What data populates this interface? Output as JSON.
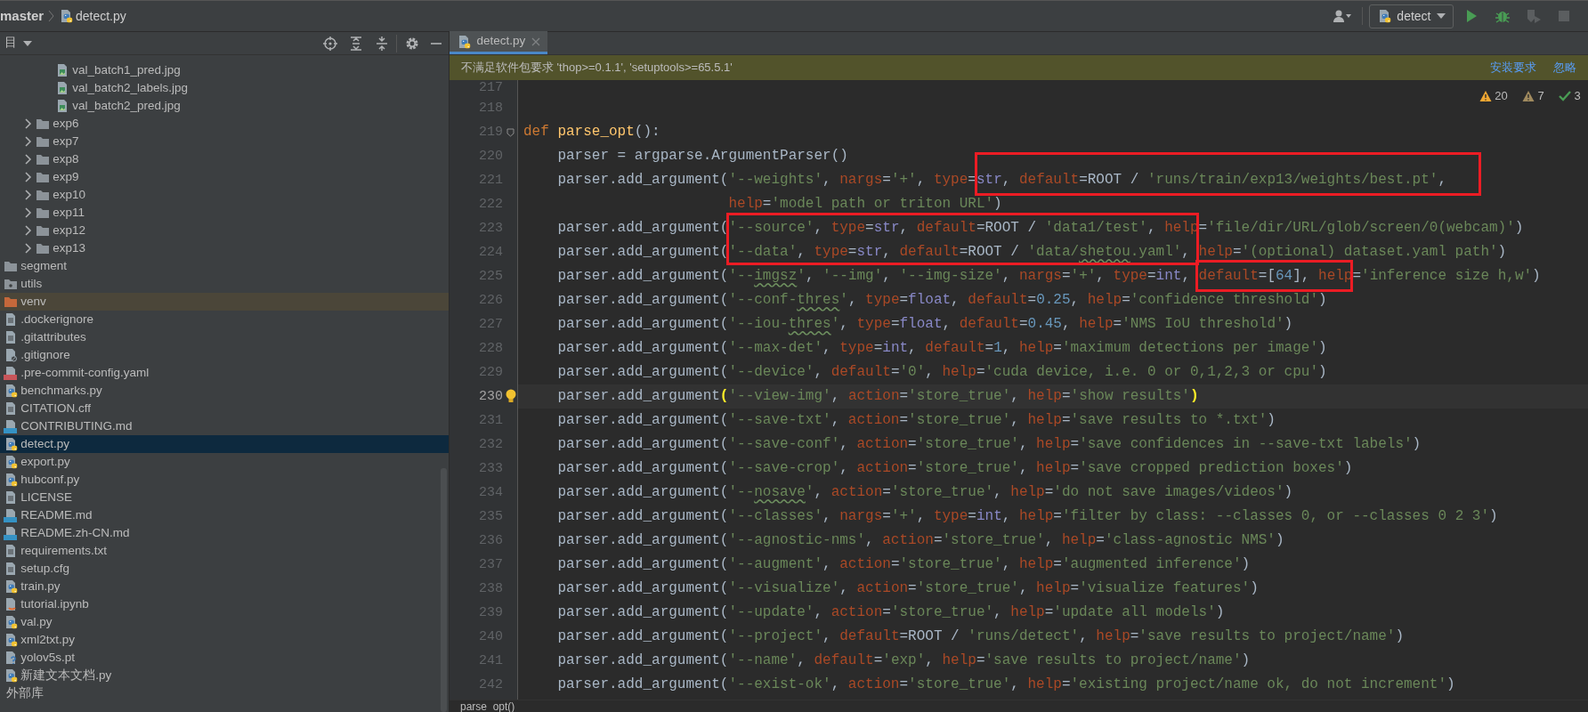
{
  "breadcrumb": [
    {
      "kind": "branch",
      "text": "master"
    },
    {
      "kind": "python",
      "text": "detect.py"
    }
  ],
  "run_config": {
    "name": "detect"
  },
  "run_buttons": [
    {
      "kind": "run",
      "disabled": false
    },
    {
      "kind": "debug",
      "disabled": false
    },
    {
      "kind": "coverage",
      "disabled": true
    },
    {
      "kind": "stop",
      "disabled": true
    }
  ],
  "project_panel": {
    "title": "目",
    "tree": [
      {
        "children": [
          {
            "children": [
              {
                "name": "val_batch1_pred.jpg",
                "kind": "image",
                "selected": false
              },
              {
                "name": "val_batch2_labels.jpg",
                "kind": "image",
                "selected": false
              },
              {
                "name": "val_batch2_pred.jpg",
                "kind": "image",
                "selected": false
              }
            ]
          },
          {
            "name": "exp6",
            "kind": "folder",
            "expanded": false,
            "excluded": false,
            "selected": false
          },
          {
            "name": "exp7",
            "kind": "folder",
            "expanded": false,
            "excluded": false,
            "selected": false
          },
          {
            "name": "exp8",
            "kind": "folder",
            "expanded": false,
            "excluded": false,
            "selected": false
          },
          {
            "name": "exp9",
            "kind": "folder",
            "expanded": false,
            "excluded": false,
            "selected": false
          },
          {
            "name": "exp10",
            "kind": "folder",
            "expanded": false,
            "excluded": false,
            "selected": false
          },
          {
            "name": "exp11",
            "kind": "folder",
            "expanded": false,
            "excluded": false,
            "selected": false
          },
          {
            "name": "exp12",
            "kind": "folder",
            "expanded": false,
            "excluded": false,
            "selected": false
          },
          {
            "name": "exp13",
            "kind": "folder",
            "expanded": false,
            "excluded": false,
            "selected": false
          }
        ]
      },
      {
        "name": "segment",
        "kind": "folder",
        "excluded": false,
        "selected": false
      },
      {
        "name": "utils",
        "kind": "package",
        "excluded": false,
        "selected": false
      },
      {
        "name": "venv",
        "kind": "folder",
        "excluded": true,
        "selected": false
      },
      {
        "name": ".dockerignore",
        "kind": "text",
        "selected": false
      },
      {
        "name": ".gitattributes",
        "kind": "text",
        "selected": false
      },
      {
        "name": ".gitignore",
        "kind": "ignore",
        "selected": false
      },
      {
        "name": ".pre-commit-config.yaml",
        "kind": "yaml",
        "selected": false
      },
      {
        "name": "benchmarks.py",
        "kind": "python",
        "selected": false
      },
      {
        "name": "CITATION.cff",
        "kind": "text",
        "selected": false
      },
      {
        "name": "CONTRIBUTING.md",
        "kind": "markdown",
        "selected": false
      },
      {
        "name": "detect.py",
        "kind": "python",
        "selected": true
      },
      {
        "name": "export.py",
        "kind": "python",
        "selected": false
      },
      {
        "name": "hubconf.py",
        "kind": "python",
        "selected": false
      },
      {
        "name": "LICENSE",
        "kind": "text",
        "selected": false
      },
      {
        "name": "README.md",
        "kind": "markdown",
        "selected": false
      },
      {
        "name": "README.zh-CN.md",
        "kind": "markdown",
        "selected": false
      },
      {
        "name": "requirements.txt",
        "kind": "text",
        "selected": false
      },
      {
        "name": "setup.cfg",
        "kind": "text",
        "selected": false
      },
      {
        "name": "train.py",
        "kind": "python",
        "selected": false
      },
      {
        "name": "tutorial.ipynb",
        "kind": "notebook",
        "selected": false
      },
      {
        "name": "val.py",
        "kind": "python",
        "selected": false
      },
      {
        "name": "xml2txt.py",
        "kind": "python",
        "selected": false
      },
      {
        "name": "yolov5s.pt",
        "kind": "unknown",
        "selected": false
      },
      {
        "name": "新建文本文档.py",
        "kind": "python",
        "selected": false
      },
      {
        "name": "外部库",
        "kind": "section",
        "selected": false
      }
    ]
  },
  "editor": {
    "tabs": [
      {
        "label": "detect.py",
        "kind": "python",
        "selected": true
      }
    ],
    "banner": {
      "message": "不满足软件包要求 'thop>=0.1.1', 'setuptools>=65.5.1'",
      "actions": [
        "安装要求",
        "忽略"
      ]
    },
    "inspections": [
      {
        "kind": "warning",
        "count": "20"
      },
      {
        "kind": "weak",
        "count": "7"
      },
      {
        "kind": "ok",
        "count": "3"
      }
    ],
    "lines": [
      {
        "number": "217",
        "kind": "code",
        "current": false
      },
      {
        "number": "218",
        "kind": "code",
        "current": false
      },
      {
        "number": "219",
        "kind": "fold",
        "current": false,
        "tokens": [
          {
            "kind": "keyword",
            "text": "def "
          },
          {
            "kind": "function",
            "text": "parse_opt"
          },
          {
            "kind": "plain",
            "text": "():"
          }
        ]
      },
      {
        "number": "220",
        "kind": "code",
        "current": false,
        "tokens": [
          {
            "kind": "plain",
            "text": "    parser = argparse.ArgumentParser()"
          }
        ]
      },
      {
        "number": "221",
        "kind": "code",
        "current": false,
        "tokens": [
          {
            "kind": "plain",
            "text": "    parser.add_argument("
          },
          {
            "kind": "string",
            "text": "'--weights'"
          },
          {
            "kind": "plain",
            "text": ", "
          },
          {
            "kind": "kwarg",
            "text": "nargs"
          },
          {
            "kind": "plain",
            "text": "="
          },
          {
            "kind": "string",
            "text": "'+'"
          },
          {
            "kind": "plain",
            "text": ", "
          },
          {
            "kind": "kwarg",
            "text": "type"
          },
          {
            "kind": "plain",
            "text": "="
          },
          {
            "kind": "builtin",
            "text": "str"
          },
          {
            "kind": "plain",
            "text": ", "
          },
          {
            "kind": "kwarg",
            "text": "default"
          },
          {
            "kind": "plain",
            "text": "=ROOT / "
          },
          {
            "kind": "string",
            "text": "'runs/train/exp13/weights/best.pt'"
          },
          {
            "kind": "plain",
            "text": ","
          }
        ]
      },
      {
        "number": "222",
        "kind": "code",
        "current": false,
        "tokens": [
          {
            "kind": "kwarg",
            "text": "                        help"
          },
          {
            "kind": "plain",
            "text": "="
          },
          {
            "kind": "string",
            "text": "'model path or triton URL'"
          },
          {
            "kind": "plain",
            "text": ")"
          }
        ]
      },
      {
        "number": "223",
        "kind": "code",
        "current": false,
        "tokens": [
          {
            "kind": "plain",
            "text": "    parser.add_argument("
          },
          {
            "kind": "string",
            "text": "'--source'"
          },
          {
            "kind": "plain",
            "text": ", "
          },
          {
            "kind": "kwarg",
            "text": "type"
          },
          {
            "kind": "plain",
            "text": "="
          },
          {
            "kind": "builtin",
            "text": "str"
          },
          {
            "kind": "plain",
            "text": ", "
          },
          {
            "kind": "kwarg",
            "text": "default"
          },
          {
            "kind": "plain",
            "text": "=ROOT / "
          },
          {
            "kind": "string",
            "text": "'data1/test'"
          },
          {
            "kind": "plain",
            "text": ", "
          },
          {
            "kind": "kwarg",
            "text": "help"
          },
          {
            "kind": "plain",
            "text": "="
          },
          {
            "kind": "string",
            "text": "'file/dir/URL/glob/screen/0(webcam)'"
          },
          {
            "kind": "plain",
            "text": ")"
          }
        ]
      },
      {
        "number": "224",
        "kind": "code",
        "current": false,
        "tokens": [
          {
            "kind": "plain",
            "text": "    parser.add_argument("
          },
          {
            "kind": "string",
            "text": "'--data'"
          },
          {
            "kind": "plain",
            "text": ", "
          },
          {
            "kind": "kwarg",
            "text": "type"
          },
          {
            "kind": "plain",
            "text": "="
          },
          {
            "kind": "builtin",
            "text": "str"
          },
          {
            "kind": "plain",
            "text": ", "
          },
          {
            "kind": "kwarg",
            "text": "default"
          },
          {
            "kind": "plain",
            "text": "=ROOT / "
          },
          {
            "kind": "string",
            "text": "'data/"
          },
          {
            "kind": "typo",
            "text": "shetou"
          },
          {
            "kind": "string",
            "text": ".yaml'"
          },
          {
            "kind": "plain",
            "text": ", "
          },
          {
            "kind": "kwarg",
            "text": "help"
          },
          {
            "kind": "plain",
            "text": "="
          },
          {
            "kind": "string",
            "text": "'(optional) dataset.yaml path'"
          },
          {
            "kind": "plain",
            "text": ")"
          }
        ]
      },
      {
        "number": "225",
        "kind": "code",
        "current": false,
        "tokens": [
          {
            "kind": "plain",
            "text": "    parser.add_argument("
          },
          {
            "kind": "string",
            "text": "'--"
          },
          {
            "kind": "typo",
            "text": "imgsz"
          },
          {
            "kind": "string",
            "text": "'"
          },
          {
            "kind": "plain",
            "text": ", "
          },
          {
            "kind": "string",
            "text": "'--img'"
          },
          {
            "kind": "plain",
            "text": ", "
          },
          {
            "kind": "string",
            "text": "'--img-size'"
          },
          {
            "kind": "plain",
            "text": ", "
          },
          {
            "kind": "kwarg",
            "text": "nargs"
          },
          {
            "kind": "plain",
            "text": "="
          },
          {
            "kind": "string",
            "text": "'+'"
          },
          {
            "kind": "plain",
            "text": ", "
          },
          {
            "kind": "kwarg",
            "text": "type"
          },
          {
            "kind": "plain",
            "text": "="
          },
          {
            "kind": "builtin",
            "text": "int"
          },
          {
            "kind": "plain",
            "text": ", "
          },
          {
            "kind": "kwarg",
            "text": "default"
          },
          {
            "kind": "plain",
            "text": "=["
          },
          {
            "kind": "number",
            "text": "64"
          },
          {
            "kind": "plain",
            "text": "], "
          },
          {
            "kind": "kwarg",
            "text": "help"
          },
          {
            "kind": "plain",
            "text": "="
          },
          {
            "kind": "string",
            "text": "'inference size h,w'"
          },
          {
            "kind": "plain",
            "text": ")"
          }
        ]
      },
      {
        "number": "226",
        "kind": "code",
        "current": false,
        "tokens": [
          {
            "kind": "plain",
            "text": "    parser.add_argument("
          },
          {
            "kind": "string",
            "text": "'--conf-"
          },
          {
            "kind": "typo",
            "text": "thres"
          },
          {
            "kind": "string",
            "text": "'"
          },
          {
            "kind": "plain",
            "text": ", "
          },
          {
            "kind": "kwarg",
            "text": "type"
          },
          {
            "kind": "plain",
            "text": "="
          },
          {
            "kind": "builtin",
            "text": "float"
          },
          {
            "kind": "plain",
            "text": ", "
          },
          {
            "kind": "kwarg",
            "text": "default"
          },
          {
            "kind": "plain",
            "text": "="
          },
          {
            "kind": "number",
            "text": "0.25"
          },
          {
            "kind": "plain",
            "text": ", "
          },
          {
            "kind": "kwarg",
            "text": "help"
          },
          {
            "kind": "plain",
            "text": "="
          },
          {
            "kind": "string",
            "text": "'confidence threshold'"
          },
          {
            "kind": "plain",
            "text": ")"
          }
        ]
      },
      {
        "number": "227",
        "kind": "code",
        "current": false,
        "tokens": [
          {
            "kind": "plain",
            "text": "    parser.add_argument("
          },
          {
            "kind": "string",
            "text": "'--iou-"
          },
          {
            "kind": "typo",
            "text": "thres"
          },
          {
            "kind": "string",
            "text": "'"
          },
          {
            "kind": "plain",
            "text": ", "
          },
          {
            "kind": "kwarg",
            "text": "type"
          },
          {
            "kind": "plain",
            "text": "="
          },
          {
            "kind": "builtin",
            "text": "float"
          },
          {
            "kind": "plain",
            "text": ", "
          },
          {
            "kind": "kwarg",
            "text": "default"
          },
          {
            "kind": "plain",
            "text": "="
          },
          {
            "kind": "number",
            "text": "0.45"
          },
          {
            "kind": "plain",
            "text": ", "
          },
          {
            "kind": "kwarg",
            "text": "help"
          },
          {
            "kind": "plain",
            "text": "="
          },
          {
            "kind": "string",
            "text": "'NMS IoU threshold'"
          },
          {
            "kind": "plain",
            "text": ")"
          }
        ]
      },
      {
        "number": "228",
        "kind": "code",
        "current": false,
        "tokens": [
          {
            "kind": "plain",
            "text": "    parser.add_argument("
          },
          {
            "kind": "string",
            "text": "'--max-det'"
          },
          {
            "kind": "plain",
            "text": ", "
          },
          {
            "kind": "kwarg",
            "text": "type"
          },
          {
            "kind": "plain",
            "text": "="
          },
          {
            "kind": "builtin",
            "text": "int"
          },
          {
            "kind": "plain",
            "text": ", "
          },
          {
            "kind": "kwarg",
            "text": "default"
          },
          {
            "kind": "plain",
            "text": "="
          },
          {
            "kind": "number",
            "text": "1"
          },
          {
            "kind": "plain",
            "text": ", "
          },
          {
            "kind": "kwarg",
            "text": "help"
          },
          {
            "kind": "plain",
            "text": "="
          },
          {
            "kind": "string",
            "text": "'maximum detections per image'"
          },
          {
            "kind": "plain",
            "text": ")"
          }
        ]
      },
      {
        "number": "229",
        "kind": "code",
        "current": false,
        "tokens": [
          {
            "kind": "plain",
            "text": "    parser.add_argument("
          },
          {
            "kind": "string",
            "text": "'--device'"
          },
          {
            "kind": "plain",
            "text": ", "
          },
          {
            "kind": "kwarg",
            "text": "default"
          },
          {
            "kind": "plain",
            "text": "="
          },
          {
            "kind": "string",
            "text": "'0'"
          },
          {
            "kind": "plain",
            "text": ", "
          },
          {
            "kind": "kwarg",
            "text": "help"
          },
          {
            "kind": "plain",
            "text": "="
          },
          {
            "kind": "string",
            "text": "'cuda device, i.e. 0 or 0,1,2,3 or cpu'"
          },
          {
            "kind": "plain",
            "text": ")"
          }
        ]
      },
      {
        "number": "230",
        "kind": "bulb",
        "current": true,
        "tokens": [
          {
            "kind": "plain",
            "text": "    parser.add_argument"
          },
          {
            "kind": "brace",
            "text": "("
          },
          {
            "kind": "string",
            "text": "'--view-img'"
          },
          {
            "kind": "plain",
            "text": ", "
          },
          {
            "kind": "kwarg",
            "text": "action"
          },
          {
            "kind": "plain",
            "text": "="
          },
          {
            "kind": "string",
            "text": "'store_true'"
          },
          {
            "kind": "plain",
            "text": ", "
          },
          {
            "kind": "kwarg",
            "text": "help"
          },
          {
            "kind": "plain",
            "text": "="
          },
          {
            "kind": "string",
            "text": "'show results'"
          },
          {
            "kind": "brace",
            "text": ")"
          }
        ]
      },
      {
        "number": "231",
        "kind": "code",
        "current": false,
        "tokens": [
          {
            "kind": "plain",
            "text": "    parser.add_argument("
          },
          {
            "kind": "string",
            "text": "'--save-txt'"
          },
          {
            "kind": "plain",
            "text": ", "
          },
          {
            "kind": "kwarg",
            "text": "action"
          },
          {
            "kind": "plain",
            "text": "="
          },
          {
            "kind": "string",
            "text": "'store_true'"
          },
          {
            "kind": "plain",
            "text": ", "
          },
          {
            "kind": "kwarg",
            "text": "help"
          },
          {
            "kind": "plain",
            "text": "="
          },
          {
            "kind": "string",
            "text": "'save results to *.txt'"
          },
          {
            "kind": "plain",
            "text": ")"
          }
        ]
      },
      {
        "number": "232",
        "kind": "code",
        "current": false,
        "tokens": [
          {
            "kind": "plain",
            "text": "    parser.add_argument("
          },
          {
            "kind": "string",
            "text": "'--save-conf'"
          },
          {
            "kind": "plain",
            "text": ", "
          },
          {
            "kind": "kwarg",
            "text": "action"
          },
          {
            "kind": "plain",
            "text": "="
          },
          {
            "kind": "string",
            "text": "'store_true'"
          },
          {
            "kind": "plain",
            "text": ", "
          },
          {
            "kind": "kwarg",
            "text": "help"
          },
          {
            "kind": "plain",
            "text": "="
          },
          {
            "kind": "string",
            "text": "'save confidences in --save-txt labels'"
          },
          {
            "kind": "plain",
            "text": ")"
          }
        ]
      },
      {
        "number": "233",
        "kind": "code",
        "current": false,
        "tokens": [
          {
            "kind": "plain",
            "text": "    parser.add_argument("
          },
          {
            "kind": "string",
            "text": "'--save-crop'"
          },
          {
            "kind": "plain",
            "text": ", "
          },
          {
            "kind": "kwarg",
            "text": "action"
          },
          {
            "kind": "plain",
            "text": "="
          },
          {
            "kind": "string",
            "text": "'store_true'"
          },
          {
            "kind": "plain",
            "text": ", "
          },
          {
            "kind": "kwarg",
            "text": "help"
          },
          {
            "kind": "plain",
            "text": "="
          },
          {
            "kind": "string",
            "text": "'save cropped prediction boxes'"
          },
          {
            "kind": "plain",
            "text": ")"
          }
        ]
      },
      {
        "number": "234",
        "kind": "code",
        "current": false,
        "tokens": [
          {
            "kind": "plain",
            "text": "    parser.add_argument("
          },
          {
            "kind": "string",
            "text": "'--"
          },
          {
            "kind": "typo",
            "text": "nosave"
          },
          {
            "kind": "string",
            "text": "'"
          },
          {
            "kind": "plain",
            "text": ", "
          },
          {
            "kind": "kwarg",
            "text": "action"
          },
          {
            "kind": "plain",
            "text": "="
          },
          {
            "kind": "string",
            "text": "'store_true'"
          },
          {
            "kind": "plain",
            "text": ", "
          },
          {
            "kind": "kwarg",
            "text": "help"
          },
          {
            "kind": "plain",
            "text": "="
          },
          {
            "kind": "string",
            "text": "'do not save images/videos'"
          },
          {
            "kind": "plain",
            "text": ")"
          }
        ]
      },
      {
        "number": "235",
        "kind": "code",
        "current": false,
        "tokens": [
          {
            "kind": "plain",
            "text": "    parser.add_argument("
          },
          {
            "kind": "string",
            "text": "'--classes'"
          },
          {
            "kind": "plain",
            "text": ", "
          },
          {
            "kind": "kwarg",
            "text": "nargs"
          },
          {
            "kind": "plain",
            "text": "="
          },
          {
            "kind": "string",
            "text": "'+'"
          },
          {
            "kind": "plain",
            "text": ", "
          },
          {
            "kind": "kwarg",
            "text": "type"
          },
          {
            "kind": "plain",
            "text": "="
          },
          {
            "kind": "builtin",
            "text": "int"
          },
          {
            "kind": "plain",
            "text": ", "
          },
          {
            "kind": "kwarg",
            "text": "help"
          },
          {
            "kind": "plain",
            "text": "="
          },
          {
            "kind": "string",
            "text": "'filter by class: --classes 0, or --classes 0 2 3'"
          },
          {
            "kind": "plain",
            "text": ")"
          }
        ]
      },
      {
        "number": "236",
        "kind": "code",
        "current": false,
        "tokens": [
          {
            "kind": "plain",
            "text": "    parser.add_argument("
          },
          {
            "kind": "string",
            "text": "'--agnostic-nms'"
          },
          {
            "kind": "plain",
            "text": ", "
          },
          {
            "kind": "kwarg",
            "text": "action"
          },
          {
            "kind": "plain",
            "text": "="
          },
          {
            "kind": "string",
            "text": "'store_true'"
          },
          {
            "kind": "plain",
            "text": ", "
          },
          {
            "kind": "kwarg",
            "text": "help"
          },
          {
            "kind": "plain",
            "text": "="
          },
          {
            "kind": "string",
            "text": "'class-agnostic NMS'"
          },
          {
            "kind": "plain",
            "text": ")"
          }
        ]
      },
      {
        "number": "237",
        "kind": "code",
        "current": false,
        "tokens": [
          {
            "kind": "plain",
            "text": "    parser.add_argument("
          },
          {
            "kind": "string",
            "text": "'--augment'"
          },
          {
            "kind": "plain",
            "text": ", "
          },
          {
            "kind": "kwarg",
            "text": "action"
          },
          {
            "kind": "plain",
            "text": "="
          },
          {
            "kind": "string",
            "text": "'store_true'"
          },
          {
            "kind": "plain",
            "text": ", "
          },
          {
            "kind": "kwarg",
            "text": "help"
          },
          {
            "kind": "plain",
            "text": "="
          },
          {
            "kind": "string",
            "text": "'augmented inference'"
          },
          {
            "kind": "plain",
            "text": ")"
          }
        ]
      },
      {
        "number": "238",
        "kind": "code",
        "current": false,
        "tokens": [
          {
            "kind": "plain",
            "text": "    parser.add_argument("
          },
          {
            "kind": "string",
            "text": "'--visualize'"
          },
          {
            "kind": "plain",
            "text": ", "
          },
          {
            "kind": "kwarg",
            "text": "action"
          },
          {
            "kind": "plain",
            "text": "="
          },
          {
            "kind": "string",
            "text": "'store_true'"
          },
          {
            "kind": "plain",
            "text": ", "
          },
          {
            "kind": "kwarg",
            "text": "help"
          },
          {
            "kind": "plain",
            "text": "="
          },
          {
            "kind": "string",
            "text": "'visualize features'"
          },
          {
            "kind": "plain",
            "text": ")"
          }
        ]
      },
      {
        "number": "239",
        "kind": "code",
        "current": false,
        "tokens": [
          {
            "kind": "plain",
            "text": "    parser.add_argument("
          },
          {
            "kind": "string",
            "text": "'--update'"
          },
          {
            "kind": "plain",
            "text": ", "
          },
          {
            "kind": "kwarg",
            "text": "action"
          },
          {
            "kind": "plain",
            "text": "="
          },
          {
            "kind": "string",
            "text": "'store_true'"
          },
          {
            "kind": "plain",
            "text": ", "
          },
          {
            "kind": "kwarg",
            "text": "help"
          },
          {
            "kind": "plain",
            "text": "="
          },
          {
            "kind": "string",
            "text": "'update all models'"
          },
          {
            "kind": "plain",
            "text": ")"
          }
        ]
      },
      {
        "number": "240",
        "kind": "code",
        "current": false,
        "tokens": [
          {
            "kind": "plain",
            "text": "    parser.add_argument("
          },
          {
            "kind": "string",
            "text": "'--project'"
          },
          {
            "kind": "plain",
            "text": ", "
          },
          {
            "kind": "kwarg",
            "text": "default"
          },
          {
            "kind": "plain",
            "text": "=ROOT / "
          },
          {
            "kind": "string",
            "text": "'runs/detect'"
          },
          {
            "kind": "plain",
            "text": ", "
          },
          {
            "kind": "kwarg",
            "text": "help"
          },
          {
            "kind": "plain",
            "text": "="
          },
          {
            "kind": "string",
            "text": "'save results to project/name'"
          },
          {
            "kind": "plain",
            "text": ")"
          }
        ]
      },
      {
        "number": "241",
        "kind": "code",
        "current": false,
        "tokens": [
          {
            "kind": "plain",
            "text": "    parser.add_argument("
          },
          {
            "kind": "string",
            "text": "'--name'"
          },
          {
            "kind": "plain",
            "text": ", "
          },
          {
            "kind": "kwarg",
            "text": "default"
          },
          {
            "kind": "plain",
            "text": "="
          },
          {
            "kind": "string",
            "text": "'exp'"
          },
          {
            "kind": "plain",
            "text": ", "
          },
          {
            "kind": "kwarg",
            "text": "help"
          },
          {
            "kind": "plain",
            "text": "="
          },
          {
            "kind": "string",
            "text": "'save results to project/name'"
          },
          {
            "kind": "plain",
            "text": ")"
          }
        ]
      },
      {
        "number": "242",
        "kind": "code",
        "current": false,
        "tokens": [
          {
            "kind": "plain",
            "text": "    parser.add_argument("
          },
          {
            "kind": "string",
            "text": "'--exist-ok'"
          },
          {
            "kind": "plain",
            "text": ", "
          },
          {
            "kind": "kwarg",
            "text": "action"
          },
          {
            "kind": "plain",
            "text": "="
          },
          {
            "kind": "string",
            "text": "'store_true'"
          },
          {
            "kind": "plain",
            "text": ", "
          },
          {
            "kind": "kwarg",
            "text": "help"
          },
          {
            "kind": "plain",
            "text": "="
          },
          {
            "kind": "string",
            "text": "'existing project/name ok, do not increment'"
          },
          {
            "kind": "plain",
            "text": ")"
          }
        ]
      }
    ],
    "annotation_frames": [
      {
        "kind": "frame"
      },
      {
        "kind": "frame"
      },
      {
        "kind": "frame"
      }
    ],
    "breadcrumb": "parse_opt()"
  }
}
